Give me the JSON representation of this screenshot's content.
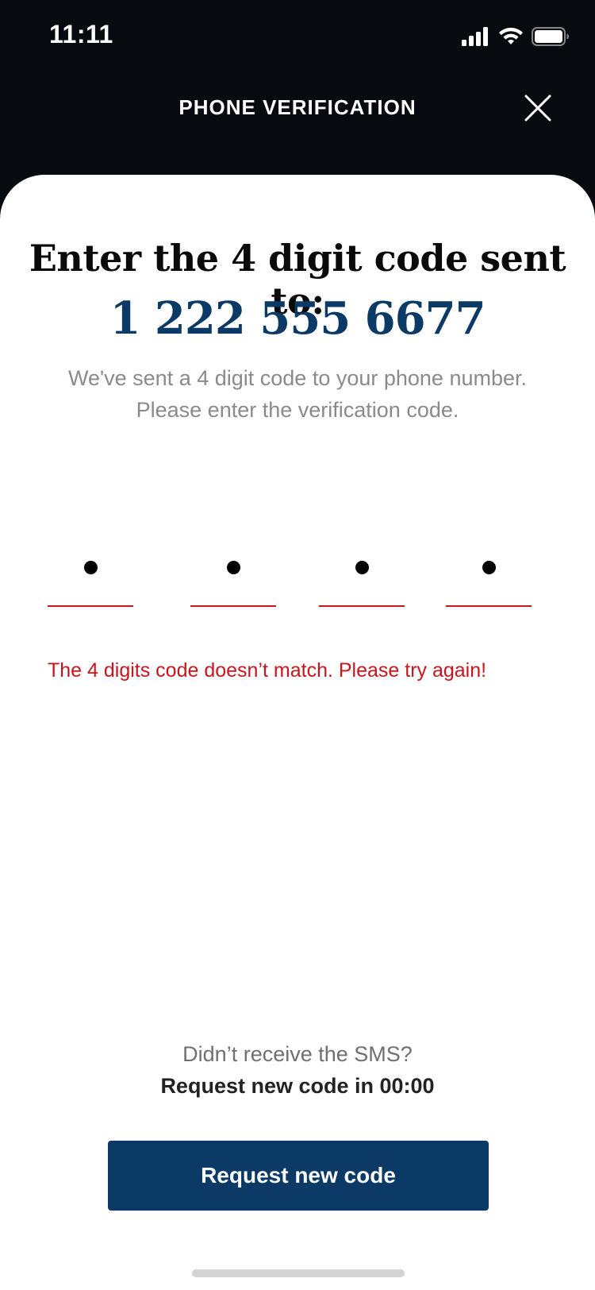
{
  "status_bar": {
    "time": "11:11",
    "icons": [
      "signal-icon",
      "wifi-icon",
      "battery-icon"
    ]
  },
  "header": {
    "title": "PHONE VERIFICATION",
    "close_icon": "close-icon"
  },
  "main": {
    "heading": "Enter the 4 digit code sent to:",
    "phone_number": "1 222 555 6677",
    "description": "We've sent a 4 digit code to your phone number. Please enter the verification code.",
    "code_digits": [
      "•",
      "•",
      "•",
      "•"
    ],
    "error_message": "The 4 digits code doesn’t match. Please try again!"
  },
  "resend": {
    "prompt": "Didn’t receive the SMS?",
    "timer_text": "Request new code in 00:00",
    "button_label": "Request new code"
  },
  "colors": {
    "primary": "#0c3a67",
    "error": "#c8161d",
    "header_bg": "#070b0f"
  }
}
